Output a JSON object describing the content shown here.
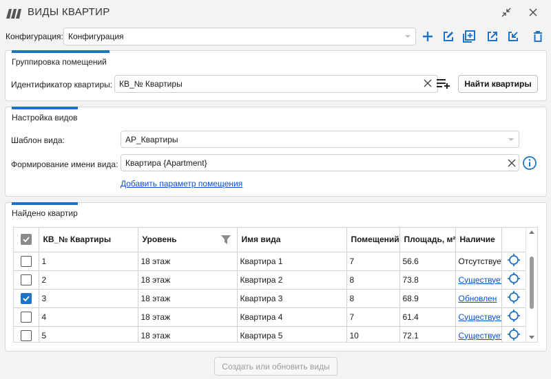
{
  "window": {
    "title": "ВИДЫ КВАРТИР",
    "logo_icon": "app-logo-icon",
    "restore_icon": "collapse-arrows-icon",
    "close_icon": "close-icon"
  },
  "toolbar": {
    "config_label": "Конфигурация:",
    "config_value": "Конфигурация",
    "buttons": [
      "add-icon",
      "edit-icon",
      "duplicate-icon",
      "export-icon",
      "import-icon",
      "delete-icon"
    ],
    "accent_color": "#1f73c4"
  },
  "grouping": {
    "title": "Группировка помещений",
    "id_label": "Идентификатор квартиры:",
    "id_value": "КВ_№ Квартиры",
    "find_button": "Найти квартиры"
  },
  "view_settings": {
    "title": "Настройка видов",
    "template_label": "Шаблон вида:",
    "template_value": "АР_Квартиры",
    "name_label": "Формирование имени вида:",
    "name_value": "Квартира {Apartment}",
    "add_param_link": "Добавить параметр помещения"
  },
  "found": {
    "title": "Найдено квартир",
    "columns": [
      "КВ_№ Квартиры",
      "Уровень",
      "Имя вида",
      "Помещений",
      "Площадь, м²",
      "Наличие"
    ],
    "rows": [
      {
        "checked": false,
        "num": "1",
        "level": "18 этаж",
        "view": "Квартира 1",
        "rooms": "7",
        "area": "56.6",
        "status": "Отсутствует",
        "status_link": false
      },
      {
        "checked": false,
        "num": "2",
        "level": "18 этаж",
        "view": "Квартира 2",
        "rooms": "8",
        "area": "73.8",
        "status": "Существует",
        "status_link": true
      },
      {
        "checked": true,
        "num": "3",
        "level": "18 этаж",
        "view": "Квартира 3",
        "rooms": "8",
        "area": "68.9",
        "status": "Обновлен",
        "status_link": true
      },
      {
        "checked": false,
        "num": "4",
        "level": "18 этаж",
        "view": "Квартира 4",
        "rooms": "7",
        "area": "61.4",
        "status": "Существует",
        "status_link": true
      },
      {
        "checked": false,
        "num": "5",
        "level": "18 этаж",
        "view": "Квартира 5",
        "rooms": "10",
        "area": "72.1",
        "status": "Существует",
        "status_link": true
      }
    ]
  },
  "footer": {
    "create_button": "Создать или обновить виды"
  }
}
